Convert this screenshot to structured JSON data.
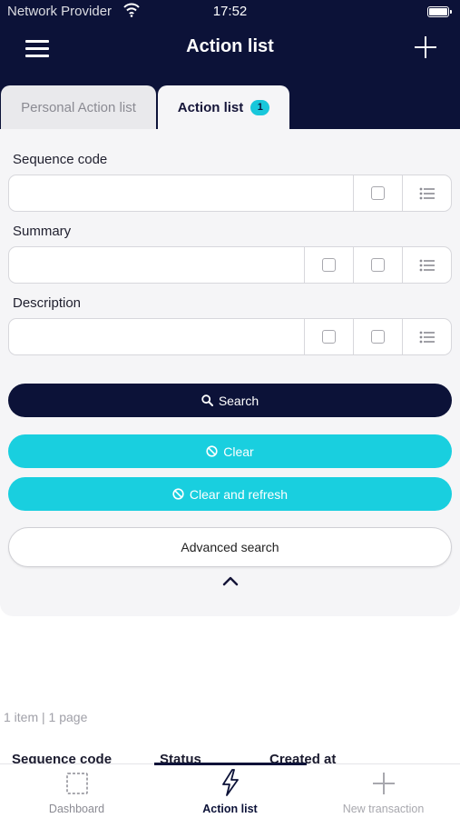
{
  "status_bar": {
    "carrier": "Network Provider",
    "time": "17:52"
  },
  "header": {
    "title": "Action list",
    "menu_icon": "hamburger-icon",
    "add_icon": "plus-icon"
  },
  "tabs": [
    {
      "label": "Personal Action list",
      "active": false
    },
    {
      "label": "Action list",
      "badge": "1",
      "active": true
    }
  ],
  "filters": {
    "sequence_code": {
      "label": "Sequence code",
      "value": ""
    },
    "summary": {
      "label": "Summary",
      "value": ""
    },
    "description": {
      "label": "Description",
      "value": ""
    }
  },
  "buttons": {
    "search": "Search",
    "clear": "Clear",
    "clear_refresh": "Clear and refresh",
    "advanced": "Advanced search"
  },
  "results": {
    "count_text": "1 item | 1 page",
    "columns": [
      "Sequence code",
      "Status",
      "Created at"
    ]
  },
  "tabbar": [
    {
      "label": "Dashboard",
      "icon": "dashboard-icon"
    },
    {
      "label": "Action list",
      "icon": "lightning-icon"
    },
    {
      "label": "New transaction",
      "icon": "plus-icon"
    }
  ],
  "colors": {
    "navy": "#0c1238",
    "cyan": "#19cfdf",
    "panel": "#f5f5f7"
  }
}
